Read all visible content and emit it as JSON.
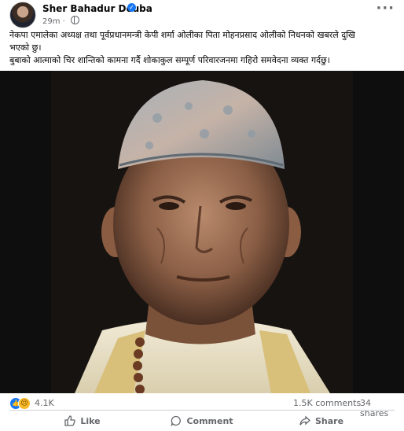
{
  "post": {
    "author": "Sher Bahadur Deuba",
    "time": "29m",
    "text_line1": "नेकपा एमालेका अध्यक्ष तथा पूर्वप्रधानमन्त्री केपी शर्मा ओलीका पिता मोहनप्रसाद ओलीको निधनको खबरले दुखि",
    "text_line2": "भएको छु।",
    "text_line3": "बुबाको आत्माको चिर शान्तिको कामना गर्दै शोकाकुल सम्पूर्ण परिवारजनमा गहिरो समवेदना व्यक्त गर्दछु।"
  },
  "stats": {
    "reaction_count": "4.1K",
    "comments": "1.5K comments",
    "shares": "34 shares"
  },
  "actions": {
    "like": "Like",
    "comment": "Comment",
    "share": "Share"
  },
  "icons": {
    "verified": "verified-badge-icon",
    "privacy": "globe-icon",
    "more": "more-options-icon",
    "like_reaction": "like-reaction-icon",
    "sad_reaction": "sad-reaction-icon"
  },
  "colors": {
    "accent": "#1877f2",
    "muted_text": "#65676b"
  }
}
